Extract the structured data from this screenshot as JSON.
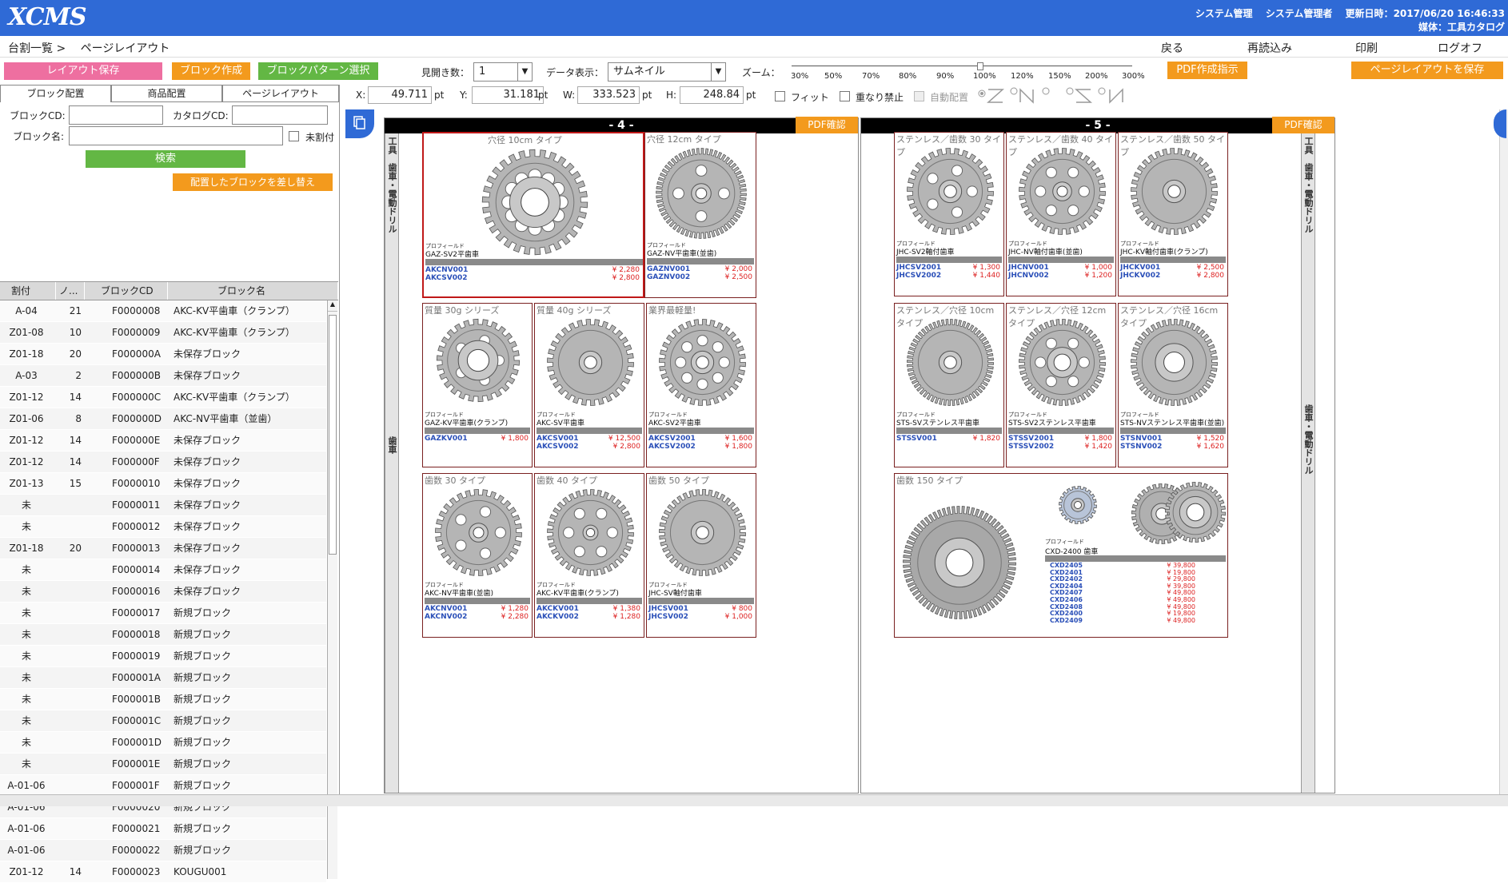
{
  "header": {
    "logo": "XCMS",
    "admin_label": "システム管理",
    "user": "システム管理者",
    "updated_label": "更新日時：",
    "updated": "2017/06/20 16:46:33",
    "media_label": "媒体：",
    "media": "工具カタログ"
  },
  "nav": {
    "breadcrumb_parent": "台割一覧 >",
    "breadcrumb_current": "ページレイアウト",
    "back": "戻る",
    "reload": "再読込み",
    "print": "印刷",
    "logout": "ログオフ"
  },
  "toolbar": {
    "save_layout": "レイアウト保存",
    "create_block": "ブロック作成",
    "select_pattern": "ブロックパターン選択",
    "spread_label": "見開き数：",
    "spread_value": "1",
    "display_label": "データ表示：",
    "display_value": "サムネイル",
    "zoom_label": "ズーム：",
    "zoom_ticks": [
      "30%",
      "50%",
      "70%",
      "80%",
      "90%",
      "100%",
      "120%",
      "150%",
      "200%",
      "300%"
    ],
    "zoom_value": "100%",
    "pdf_create": "PDF作成指示",
    "save_page_layout": "ページレイアウトを保存",
    "x_label": "X:",
    "x_value": "49.711",
    "y_label": "Y:",
    "y_value": "31.181",
    "w_label": "W:",
    "w_value": "333.523",
    "h_label": "H:",
    "h_value": "248.84",
    "unit": "pt",
    "fit": "フィット",
    "no_overlap": "重なり禁止",
    "auto_place": "自動配置"
  },
  "left": {
    "tabs": [
      "ブロック配置",
      "商品配置",
      "ページレイアウト"
    ],
    "block_cd_label": "ブロックCD:",
    "catalog_cd_label": "カタログCD:",
    "block_name_label": "ブロック名:",
    "unassigned_label": "未割付",
    "search": "検索",
    "replace": "配置したブロックを差し替え",
    "columns": [
      "割付",
      "ノ...",
      "ブロックCD",
      "ブロック名"
    ],
    "rows": [
      [
        "A-04",
        "21",
        "F0000008",
        "AKC-KV平歯車（クランプ）"
      ],
      [
        "Z01-08",
        "10",
        "F0000009",
        "AKC-KV平歯車（クランプ）"
      ],
      [
        "Z01-18",
        "20",
        "F000000A",
        "未保存ブロック"
      ],
      [
        "A-03",
        "2",
        "F000000B",
        "未保存ブロック"
      ],
      [
        "Z01-12",
        "14",
        "F000000C",
        "AKC-KV平歯車（クランプ）"
      ],
      [
        "Z01-06",
        "8",
        "F000000D",
        "AKC-NV平歯車（並歯）"
      ],
      [
        "Z01-12",
        "14",
        "F000000E",
        "未保存ブロック"
      ],
      [
        "Z01-12",
        "14",
        "F000000F",
        "未保存ブロック"
      ],
      [
        "Z01-13",
        "15",
        "F0000010",
        "未保存ブロック"
      ],
      [
        "未",
        "",
        "F0000011",
        "未保存ブロック"
      ],
      [
        "未",
        "",
        "F0000012",
        "未保存ブロック"
      ],
      [
        "Z01-18",
        "20",
        "F0000013",
        "未保存ブロック"
      ],
      [
        "未",
        "",
        "F0000014",
        "未保存ブロック"
      ],
      [
        "未",
        "",
        "F0000016",
        "未保存ブロック"
      ],
      [
        "未",
        "",
        "F0000017",
        "新規ブロック"
      ],
      [
        "未",
        "",
        "F0000018",
        "新規ブロック"
      ],
      [
        "未",
        "",
        "F0000019",
        "新規ブロック"
      ],
      [
        "未",
        "",
        "F000001A",
        "新規ブロック"
      ],
      [
        "未",
        "",
        "F000001B",
        "新規ブロック"
      ],
      [
        "未",
        "",
        "F000001C",
        "新規ブロック"
      ],
      [
        "未",
        "",
        "F000001D",
        "新規ブロック"
      ],
      [
        "未",
        "",
        "F000001E",
        "新規ブロック"
      ],
      [
        "A-01-06",
        "",
        "F000001F",
        "新規ブロック"
      ],
      [
        "A-01-06",
        "",
        "F0000020",
        "新規ブロック"
      ],
      [
        "A-01-06",
        "",
        "F0000021",
        "新規ブロック"
      ],
      [
        "A-01-06",
        "",
        "F0000022",
        "新規ブロック"
      ],
      [
        "Z01-12",
        "14",
        "F0000023",
        "KOUGU001"
      ]
    ]
  },
  "pages": {
    "left_number": "- 4 -",
    "right_number": "- 5 -",
    "pdf_check": "PDF確認",
    "side_top": "工具　歯車・電動ドリル",
    "side_mid": "歯車",
    "side_right_bottom": "歯車・電動ドリル",
    "profile_label": "プロフィールド",
    "blocks": [
      {
        "title": "穴径 10cm タイプ",
        "name": "GAZ-SV2平歯車",
        "codes": [
          "AKCNV001",
          "AKCSV002"
        ],
        "prices": [
          "¥ 2,280",
          "¥ 2,800"
        ]
      },
      {
        "title": "穴径 12cm タイプ",
        "name": "GAZ-NV平歯車(並歯)",
        "codes": [
          "GAZNV001",
          "GAZNV002"
        ],
        "prices": [
          "¥ 2,000",
          "¥ 2,500"
        ]
      },
      {
        "title": "質量 30g シリーズ",
        "name": "GAZ-KV平歯車(クランプ)",
        "codes": [
          "GAZKV001"
        ],
        "prices": [
          "¥ 1,800"
        ]
      },
      {
        "title": "質量 40g シリーズ",
        "name": "AKC-SV平歯車",
        "codes": [
          "AKCSV001",
          "AKCSV002"
        ],
        "prices": [
          "¥ 12,500",
          "¥ 2,800"
        ]
      },
      {
        "title": "業界最軽量!",
        "name": "AKC-SV2平歯車",
        "codes": [
          "AKCSV2001",
          "AKCSV2002"
        ],
        "prices": [
          "¥ 1,600",
          "¥ 1,800"
        ]
      },
      {
        "title": "歯数 30 タイプ",
        "name": "AKC-NV平歯車(並歯)",
        "codes": [
          "AKCNV001",
          "AKCNV002"
        ],
        "prices": [
          "¥ 1,280",
          "¥ 2,280"
        ]
      },
      {
        "title": "歯数 40 タイプ",
        "name": "AKC-KV平歯車(クランプ)",
        "codes": [
          "AKCKV001",
          "AKCKV002"
        ],
        "prices": [
          "¥ 1,380",
          "¥ 1,280"
        ]
      },
      {
        "title": "歯数 50 タイプ",
        "name": "JHC-SV軸付歯車",
        "codes": [
          "JHCSV001",
          "JHCSV002"
        ],
        "prices": [
          "¥ 800",
          "¥ 1,000"
        ]
      },
      {
        "title": "ステンレス／歯数 30 タイプ",
        "name": "JHC-SV2軸付歯車",
        "codes": [
          "JHCSV2001",
          "JHCSV2002"
        ],
        "prices": [
          "¥ 1,300",
          "¥ 1,440"
        ]
      },
      {
        "title": "ステンレス／歯数 40 タイプ",
        "name": "JHC-NV軸付歯車(並歯)",
        "codes": [
          "JHCNV001",
          "JHCNV002"
        ],
        "prices": [
          "¥ 1,000",
          "¥ 1,200"
        ]
      },
      {
        "title": "ステンレス／歯数 50 タイプ",
        "name": "JHC-KV軸付歯車(クランプ)",
        "codes": [
          "JHCKV001",
          "JHCKV002"
        ],
        "prices": [
          "¥ 2,500",
          "¥ 2,800"
        ]
      },
      {
        "title": "ステンレス／穴径 10cm タイプ",
        "name": "STS-SVステンレス平歯車",
        "codes": [
          "STSSV001"
        ],
        "prices": [
          "¥ 1,820"
        ]
      },
      {
        "title": "ステンレス／穴径 12cm タイプ",
        "name": "STS-SV2ステンレス平歯車",
        "codes": [
          "STSSV2001",
          "STSSV2002"
        ],
        "prices": [
          "¥ 1,800",
          "¥ 1,420"
        ]
      },
      {
        "title": "ステンレス／穴径 16cm タイプ",
        "name": "STS-NVステンレス平歯車(並歯)",
        "codes": [
          "STSNV001",
          "STSNV002"
        ],
        "prices": [
          "¥ 1,520",
          "¥ 1,620"
        ]
      }
    ],
    "big_block": {
      "title": "歯数 150 タイプ",
      "name": "CXD-2400 歯車",
      "codes": [
        "CXD2405",
        "CXD2401",
        "CXD2402",
        "CXD2404",
        "CXD2407",
        "CXD2406",
        "CXD2408",
        "CXD2400",
        "CXD2409"
      ],
      "prices": [
        "¥ 39,800",
        "¥ 19,800",
        "¥ 29,800",
        "¥ 39,800",
        "¥ 49,800",
        "¥ 49,800",
        "¥ 49,800",
        "¥ 19,800",
        "¥ 49,800"
      ]
    }
  },
  "colors": {
    "header": "#2f6ad6",
    "pink_button": "#ee6fa0",
    "orange_button": "#f39a1d",
    "green_button": "#63b744",
    "selection": "#c01818",
    "code_blue": "#2a4fb8",
    "price_red": "#dd2222"
  }
}
